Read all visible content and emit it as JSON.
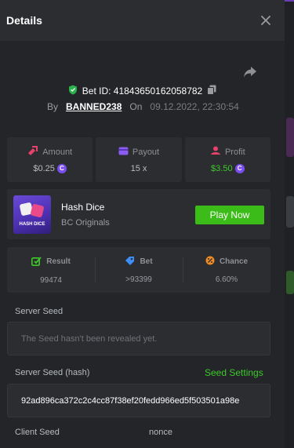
{
  "header": {
    "title": "Details"
  },
  "bet": {
    "id_label": "Bet ID: 41843650162058782",
    "by_label": "By",
    "user": "BANNED238",
    "on_label": "On",
    "date": "09.12.2022, 22:30:54"
  },
  "stats": {
    "amount": {
      "label": "Amount",
      "value": "$0.25"
    },
    "payout": {
      "label": "Payout",
      "value": "15 x"
    },
    "profit": {
      "label": "Profit",
      "value": "$3.50"
    },
    "coin_symbol": "C"
  },
  "game": {
    "thumb_text": "HASH DICE",
    "name": "Hash Dice",
    "provider": "BC Originals",
    "play_label": "Play Now"
  },
  "roll": {
    "result": {
      "label": "Result",
      "value": "99474"
    },
    "bet": {
      "label": "Bet",
      "value": ">93399"
    },
    "chance": {
      "label": "Chance",
      "value": "6.60%"
    }
  },
  "seeds": {
    "server_seed_label": "Server Seed",
    "server_seed_value": "The Seed hasn't been revealed yet.",
    "server_seed_hash_label": "Server Seed (hash)",
    "seed_settings_label": "Seed Settings",
    "server_seed_hash_value": "92ad896ca372c2c4cc87f38ef20fedd966ed5f503501a98e",
    "client_seed_label": "Client Seed",
    "nonce_label": "nonce"
  },
  "colors": {
    "accent_green": "#3cbc19",
    "profit_green": "#3ec82a",
    "coin_purple": "#7b4ef0",
    "background": "#232528",
    "panel": "#2b2d31"
  },
  "icons": [
    "close-icon",
    "share-icon",
    "shield-check-icon",
    "copy-icon",
    "amount-icon",
    "payout-icon",
    "profit-icon",
    "coin-icon",
    "result-icon",
    "bet-icon",
    "chance-icon"
  ]
}
